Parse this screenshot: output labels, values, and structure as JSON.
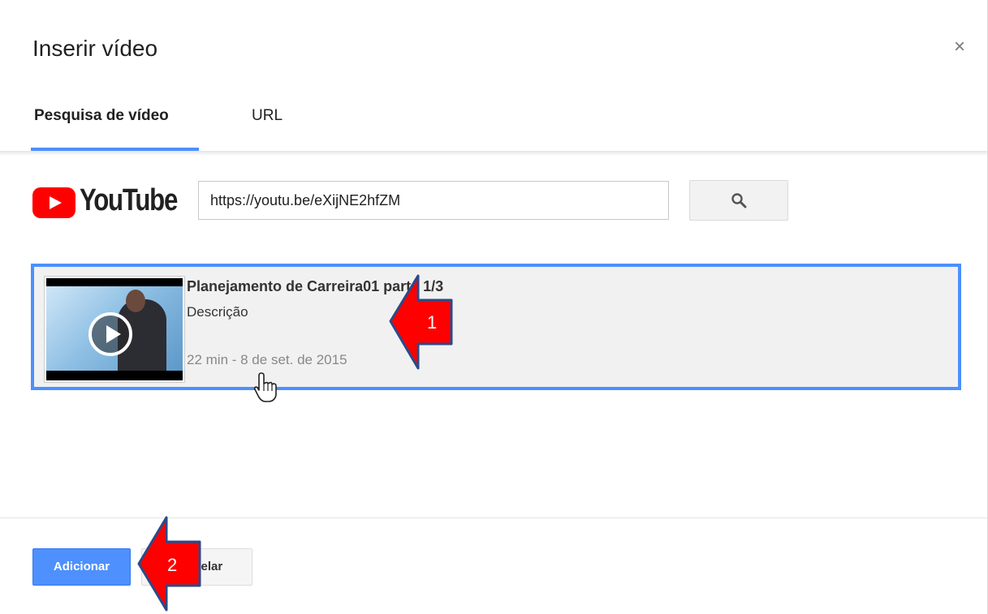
{
  "dialog": {
    "title": "Inserir vídeo",
    "close_symbol": "×"
  },
  "tabs": [
    {
      "label": "Pesquisa de vídeo",
      "active": true
    },
    {
      "label": "URL",
      "active": false
    }
  ],
  "search": {
    "logo_text": "YouTube",
    "query": "https://youtu.be/eXijNE2hfZM",
    "button_icon": "search-icon"
  },
  "result": {
    "title": "Planejamento de Carreira01 parte 1/3",
    "description": "Descrição",
    "meta": "22 min - 8 de set. de 2015",
    "selected": true
  },
  "footer": {
    "add_label": "Adicionar",
    "cancel_label": "Cancelar"
  },
  "annotations": [
    {
      "number": "1"
    },
    {
      "number": "2"
    }
  ],
  "colors": {
    "accent": "#4d90fe",
    "youtube_red": "#ff0000",
    "annotation_red": "#ff0000"
  }
}
